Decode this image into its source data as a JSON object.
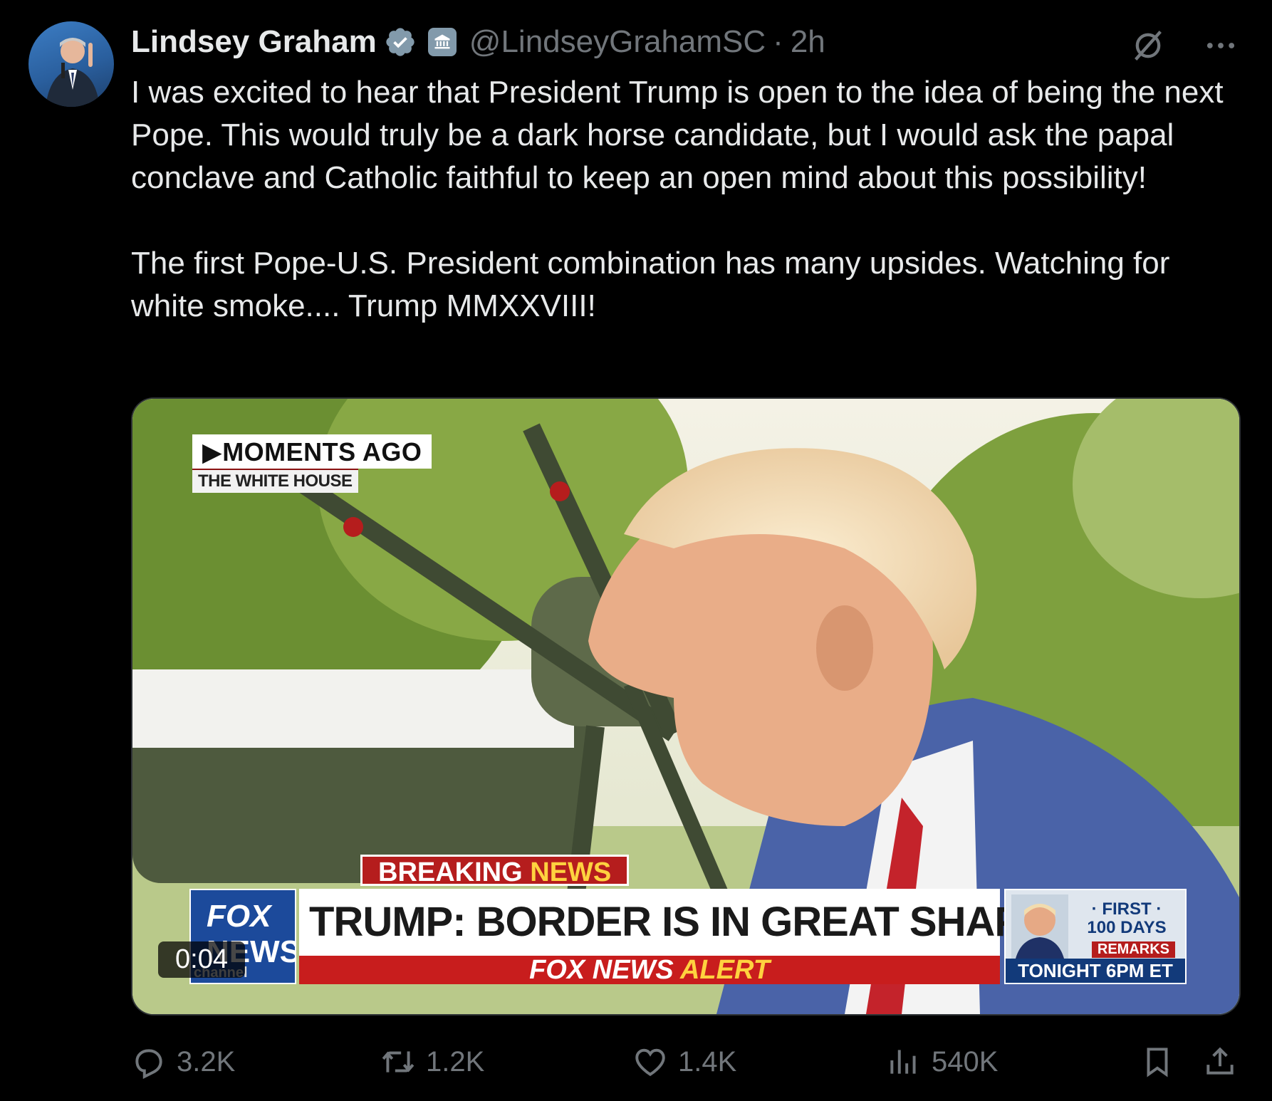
{
  "author": {
    "display_name": "Lindsey Graham",
    "handle": "@LindseyGrahamSC",
    "separator": "·",
    "time": "2h",
    "badges": [
      "verified-badge-icon",
      "government-building-icon"
    ]
  },
  "tweet": {
    "paragraph1": "I was excited to hear that President Trump is open to the idea of being the next Pope. This would truly be a dark horse candidate, but I would ask the papal conclave and Catholic faithful to keep an open mind about this possibility!",
    "paragraph2": "The first Pope-U.S. President combination has many upsides. Watching for white smoke.... Trump MMXXVIII!"
  },
  "video": {
    "duration": "0:04",
    "overlay": {
      "moments_ago": "MOMENTS AGO",
      "location": "THE WHITE HOUSE",
      "breaking": "BREAKING",
      "news": "NEWS",
      "headline": "TRUMP: BORDER IS IN GREAT SHAPE",
      "alert_prefix": "FOX NEWS",
      "alert_word": "ALERT",
      "logo_line1": "FOX",
      "logo_line2": "NEWS",
      "logo_line3": "channel",
      "promo_first": "· FIRST ·",
      "promo_days": "100 DAYS",
      "promo_remarks": "REMARKS",
      "promo_time": "TONIGHT 6PM ET"
    }
  },
  "actions": {
    "replies": "3.2K",
    "reposts": "1.2K",
    "likes": "1.4K",
    "views": "540K"
  },
  "colors": {
    "background": "#000000",
    "text": "#e7e9ea",
    "muted": "#71767b",
    "verified": "#829aab",
    "fox_red": "#c81d1d",
    "fox_blue": "#1c4a9b"
  }
}
